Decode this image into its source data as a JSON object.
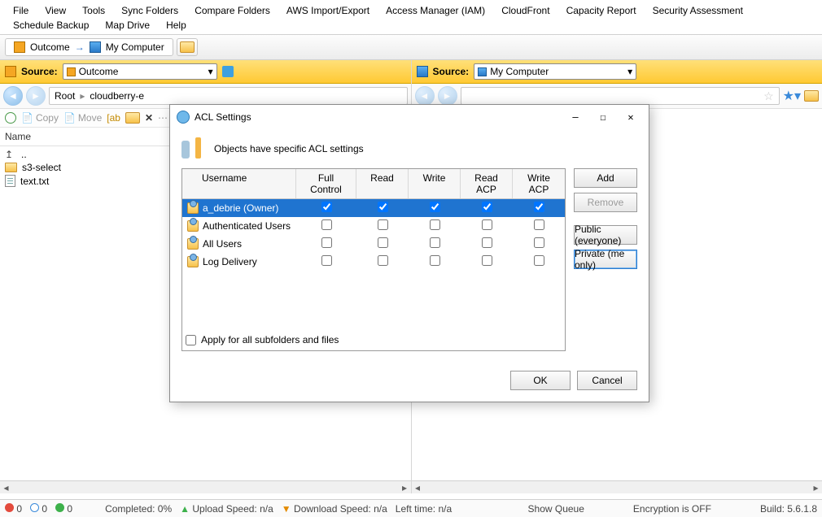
{
  "menu": [
    "File",
    "View",
    "Tools",
    "Sync Folders",
    "Compare Folders",
    "AWS Import/Export",
    "Access Manager (IAM)",
    "CloudFront",
    "Capacity Report",
    "Security Assessment",
    "Schedule Backup",
    "Map Drive",
    "Help"
  ],
  "tabs": {
    "outcome": "Outcome",
    "mycomputer": "My Computer"
  },
  "leftPane": {
    "source_label": "Source:",
    "source_value": "Outcome",
    "breadcrumb": {
      "root": "Root",
      "current": "cloudberry-e"
    },
    "toolbar": {
      "copy": "Copy",
      "move": "Move"
    },
    "header": "Name",
    "up": "..",
    "items": [
      {
        "type": "folder",
        "name": "s3-select"
      },
      {
        "type": "text",
        "name": "text.txt"
      }
    ]
  },
  "rightPane": {
    "source_label": "Source:",
    "source_value": "My Computer"
  },
  "status": {
    "counts": {
      "red": "0",
      "blue": "0",
      "green": "0"
    },
    "completed": "Completed: 0%",
    "upload": "Upload Speed: n/a",
    "download": "Download Speed: n/a",
    "lefttime": "Left time: n/a",
    "show_queue": "Show Queue",
    "encryption": "Encryption is OFF",
    "build": "Build: 5.6.1.8"
  },
  "dialog": {
    "title": "ACL Settings",
    "info": "Objects have specific ACL settings",
    "columns": [
      "Username",
      "Full Control",
      "Read",
      "Write",
      "Read ACP",
      "Write ACP"
    ],
    "rows": [
      {
        "user": "a_debrie (Owner)",
        "selected": true,
        "checks": [
          true,
          true,
          true,
          true,
          true
        ]
      },
      {
        "user": "Authenticated Users",
        "selected": false,
        "checks": [
          false,
          false,
          false,
          false,
          false
        ]
      },
      {
        "user": "All Users",
        "selected": false,
        "checks": [
          false,
          false,
          false,
          false,
          false
        ]
      },
      {
        "user": "Log Delivery",
        "selected": false,
        "checks": [
          false,
          false,
          false,
          false,
          false
        ]
      }
    ],
    "apply_label": "Apply for all subfolders and files",
    "side_buttons": {
      "add": "Add",
      "remove": "Remove",
      "public": "Public (everyone)",
      "private": "Private (me only)"
    },
    "ok": "OK",
    "cancel": "Cancel"
  }
}
